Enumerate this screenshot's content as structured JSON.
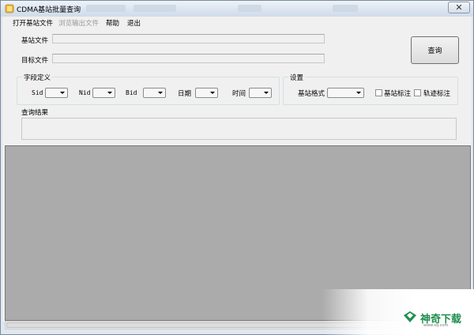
{
  "window": {
    "title": "CDMA基站批量查询",
    "close_label": "✕"
  },
  "menu": {
    "items": [
      {
        "label": "打开基站文件",
        "enabled": true
      },
      {
        "label": "浏览输出文件",
        "enabled": false
      },
      {
        "label": "帮助",
        "enabled": true
      },
      {
        "label": "退出",
        "enabled": true
      }
    ]
  },
  "form": {
    "base_file_label": "基站文件",
    "base_file_value": "",
    "target_file_label": "目标文件",
    "target_file_value": "",
    "query_button": "查询"
  },
  "field_def": {
    "title": "字段定义",
    "sid_label": "Sid",
    "nid_label": "Nid",
    "bid_label": "Bid",
    "date_label": "日期",
    "time_label": "时间",
    "sid_value": "",
    "nid_value": "",
    "bid_value": "",
    "date_value": "",
    "time_value": ""
  },
  "settings": {
    "title": "设置",
    "format_label": "基站格式",
    "format_value": "",
    "base_mark_label": "基站标注",
    "base_mark_checked": false,
    "track_mark_label": "轨迹标注",
    "track_mark_checked": false
  },
  "results": {
    "label": "查询结果",
    "value": ""
  },
  "watermark": {
    "text": "神奇下载",
    "sub": "www.sq.com"
  },
  "colors": {
    "output_area": "#ababab",
    "watermark_green": "#1f8e4e"
  },
  "icons": {
    "app": "app-icon",
    "close": "close-icon",
    "dropdown": "chevron-down-icon",
    "watermark": "logo-icon"
  }
}
